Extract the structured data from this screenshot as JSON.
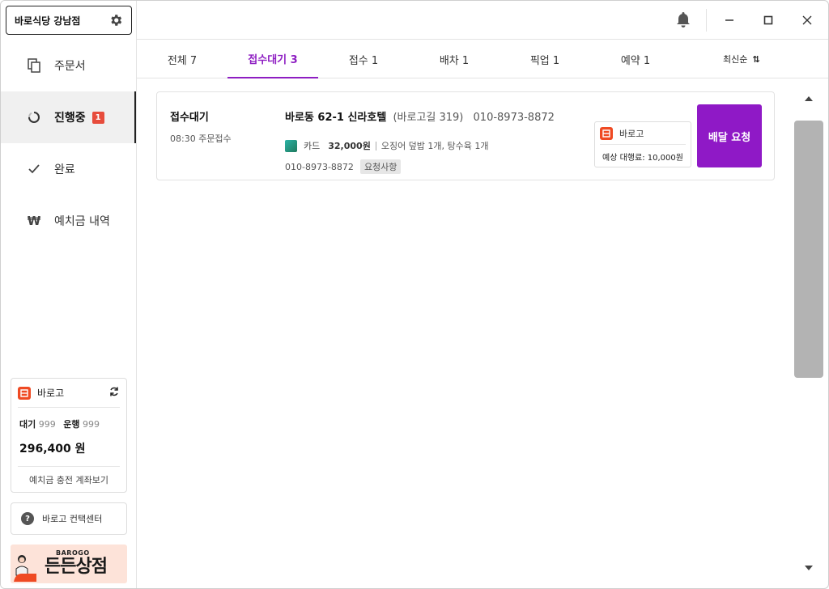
{
  "store": {
    "name": "바로식당 강남점",
    "settings_icon": "gear-icon"
  },
  "sidebar": {
    "items": [
      {
        "label": "주문서",
        "icon": "copy-icon"
      },
      {
        "label": "진행중",
        "icon": "progress-ring-icon",
        "badge": "1",
        "active": true
      },
      {
        "label": "완료",
        "icon": "check-icon"
      },
      {
        "label": "예치금 내역",
        "icon": "won-icon",
        "glyph": "₩"
      }
    ]
  },
  "barogo_card": {
    "title": "바로고",
    "waiting_label": "대기",
    "waiting_count": "999",
    "running_label": "운행",
    "running_count": "999",
    "balance": "296,400 원",
    "footer": "예치금 충전 계좌보기"
  },
  "contact": {
    "label": "바로고 컨택센터"
  },
  "banner": {
    "brand": "BAROGO",
    "slogan": "든든상점"
  },
  "tabs": [
    {
      "label": "전체 7"
    },
    {
      "label": "접수대기 3",
      "active": true
    },
    {
      "label": "접수 1"
    },
    {
      "label": "배차 1"
    },
    {
      "label": "픽업 1"
    },
    {
      "label": "예약 1"
    }
  ],
  "sort": {
    "label": "최신순",
    "icon": "sort-arrows-icon",
    "glyph": "⇅"
  },
  "order": {
    "status": "접수대기",
    "time": "08:30 주문접수",
    "address_main": "바로동 62-1 신라호텔",
    "address_road": "(바로고길 319)",
    "phone": "010-8973-8872",
    "payment_method": "카드",
    "amount": "32,000원",
    "menu": "오징어 덮밥 1개, 탕수육 1개",
    "phone2": "010-8973-8872",
    "request_badge": "요청사항",
    "agency_name": "바로고",
    "agency_fee": "예상 대행료: 10,000원",
    "deliver_button": "배달 요청"
  },
  "colors": {
    "accent": "#8f19c6",
    "barogo": "#ef4a23",
    "badge": "#e74c3c"
  }
}
